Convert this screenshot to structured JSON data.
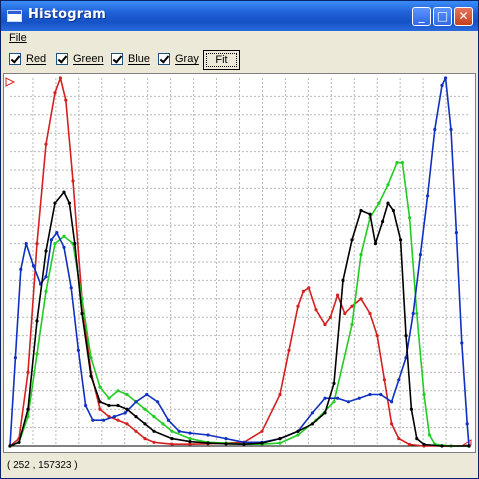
{
  "window": {
    "title": "Histogram",
    "buttons": {
      "minimize": "_",
      "maximize": "□",
      "close": "✕"
    }
  },
  "menu": {
    "file": "File"
  },
  "toolbar": {
    "checkboxes": [
      {
        "label": "Red",
        "checked": true,
        "color": "#d42020"
      },
      {
        "label": "Green",
        "checked": true,
        "color": "#22cc22"
      },
      {
        "label": "Blue",
        "checked": true,
        "color": "#1030c0"
      },
      {
        "label": "Gray",
        "checked": true,
        "color": "#000000"
      }
    ],
    "fit_label": "Fit"
  },
  "status": {
    "text": "( 252 , 157323 )"
  },
  "chart_data": {
    "type": "line",
    "title": "",
    "xlabel": "",
    "ylabel": "",
    "xlim": [
      0,
      255
    ],
    "ylim": [
      0,
      1
    ],
    "grid": true,
    "series": [
      {
        "name": "Red",
        "color": "#d42020",
        "points": [
          [
            0,
            0
          ],
          [
            5,
            0.02
          ],
          [
            10,
            0.2
          ],
          [
            15,
            0.55
          ],
          [
            20,
            0.82
          ],
          [
            25,
            0.96
          ],
          [
            28,
            1.0
          ],
          [
            31,
            0.94
          ],
          [
            35,
            0.72
          ],
          [
            40,
            0.4
          ],
          [
            45,
            0.2
          ],
          [
            50,
            0.1
          ],
          [
            55,
            0.08
          ],
          [
            60,
            0.07
          ],
          [
            65,
            0.06
          ],
          [
            70,
            0.04
          ],
          [
            75,
            0.02
          ],
          [
            80,
            0.01
          ],
          [
            90,
            0.005
          ],
          [
            100,
            0.005
          ],
          [
            110,
            0.006
          ],
          [
            120,
            0.008
          ],
          [
            130,
            0.01
          ],
          [
            140,
            0.04
          ],
          [
            150,
            0.14
          ],
          [
            155,
            0.26
          ],
          [
            160,
            0.38
          ],
          [
            163,
            0.42
          ],
          [
            166,
            0.43
          ],
          [
            170,
            0.37
          ],
          [
            175,
            0.33
          ],
          [
            178,
            0.35
          ],
          [
            182,
            0.41
          ],
          [
            186,
            0.36
          ],
          [
            190,
            0.38
          ],
          [
            195,
            0.4
          ],
          [
            200,
            0.36
          ],
          [
            204,
            0.3
          ],
          [
            208,
            0.18
          ],
          [
            212,
            0.06
          ],
          [
            216,
            0.02
          ],
          [
            222,
            0.004
          ],
          [
            230,
            0.0
          ],
          [
            245,
            0.0
          ],
          [
            255,
            0.0
          ]
        ]
      },
      {
        "name": "Green",
        "color": "#22cc22",
        "points": [
          [
            0,
            0
          ],
          [
            5,
            0.01
          ],
          [
            10,
            0.08
          ],
          [
            15,
            0.25
          ],
          [
            20,
            0.42
          ],
          [
            25,
            0.55
          ],
          [
            30,
            0.57
          ],
          [
            35,
            0.55
          ],
          [
            40,
            0.4
          ],
          [
            45,
            0.24
          ],
          [
            50,
            0.16
          ],
          [
            55,
            0.13
          ],
          [
            60,
            0.15
          ],
          [
            65,
            0.14
          ],
          [
            70,
            0.12
          ],
          [
            75,
            0.1
          ],
          [
            80,
            0.08
          ],
          [
            85,
            0.06
          ],
          [
            90,
            0.04
          ],
          [
            100,
            0.02
          ],
          [
            110,
            0.01
          ],
          [
            120,
            0.008
          ],
          [
            130,
            0.005
          ],
          [
            140,
            0.005
          ],
          [
            150,
            0.008
          ],
          [
            160,
            0.03
          ],
          [
            170,
            0.07
          ],
          [
            180,
            0.12
          ],
          [
            190,
            0.33
          ],
          [
            195,
            0.52
          ],
          [
            200,
            0.62
          ],
          [
            205,
            0.66
          ],
          [
            210,
            0.71
          ],
          [
            215,
            0.77
          ],
          [
            218,
            0.77
          ],
          [
            222,
            0.62
          ],
          [
            226,
            0.36
          ],
          [
            230,
            0.14
          ],
          [
            233,
            0.03
          ],
          [
            236,
            0.005
          ],
          [
            245,
            0.0
          ],
          [
            255,
            0.0
          ]
        ]
      },
      {
        "name": "Blue",
        "color": "#1030c0",
        "points": [
          [
            0,
            0
          ],
          [
            3,
            0.24
          ],
          [
            6,
            0.48
          ],
          [
            9,
            0.55
          ],
          [
            13,
            0.49
          ],
          [
            17,
            0.44
          ],
          [
            20,
            0.46
          ],
          [
            23,
            0.56
          ],
          [
            26,
            0.58
          ],
          [
            30,
            0.54
          ],
          [
            34,
            0.43
          ],
          [
            38,
            0.26
          ],
          [
            42,
            0.11
          ],
          [
            46,
            0.07
          ],
          [
            52,
            0.07
          ],
          [
            58,
            0.08
          ],
          [
            64,
            0.09
          ],
          [
            70,
            0.12
          ],
          [
            76,
            0.14
          ],
          [
            82,
            0.12
          ],
          [
            88,
            0.07
          ],
          [
            94,
            0.04
          ],
          [
            100,
            0.035
          ],
          [
            110,
            0.03
          ],
          [
            120,
            0.02
          ],
          [
            130,
            0.01
          ],
          [
            140,
            0.01
          ],
          [
            150,
            0.02
          ],
          [
            160,
            0.04
          ],
          [
            168,
            0.09
          ],
          [
            175,
            0.13
          ],
          [
            182,
            0.13
          ],
          [
            188,
            0.12
          ],
          [
            194,
            0.13
          ],
          [
            200,
            0.14
          ],
          [
            206,
            0.14
          ],
          [
            212,
            0.12
          ],
          [
            216,
            0.18
          ],
          [
            220,
            0.24
          ],
          [
            224,
            0.36
          ],
          [
            228,
            0.52
          ],
          [
            232,
            0.68
          ],
          [
            236,
            0.86
          ],
          [
            240,
            0.98
          ],
          [
            242,
            1.0
          ],
          [
            245,
            0.86
          ],
          [
            248,
            0.58
          ],
          [
            251,
            0.28
          ],
          [
            254,
            0.06
          ],
          [
            255,
            0.0
          ]
        ]
      },
      {
        "name": "Gray",
        "color": "#000000",
        "points": [
          [
            0,
            0
          ],
          [
            5,
            0.01
          ],
          [
            10,
            0.1
          ],
          [
            15,
            0.34
          ],
          [
            20,
            0.53
          ],
          [
            25,
            0.66
          ],
          [
            30,
            0.69
          ],
          [
            33,
            0.66
          ],
          [
            36,
            0.55
          ],
          [
            40,
            0.36
          ],
          [
            45,
            0.19
          ],
          [
            50,
            0.12
          ],
          [
            55,
            0.11
          ],
          [
            60,
            0.11
          ],
          [
            65,
            0.1
          ],
          [
            70,
            0.08
          ],
          [
            75,
            0.06
          ],
          [
            80,
            0.04
          ],
          [
            90,
            0.02
          ],
          [
            100,
            0.012
          ],
          [
            110,
            0.008
          ],
          [
            120,
            0.006
          ],
          [
            130,
            0.005
          ],
          [
            140,
            0.008
          ],
          [
            150,
            0.02
          ],
          [
            160,
            0.04
          ],
          [
            168,
            0.06
          ],
          [
            175,
            0.09
          ],
          [
            180,
            0.17
          ],
          [
            185,
            0.45
          ],
          [
            190,
            0.56
          ],
          [
            195,
            0.64
          ],
          [
            200,
            0.63
          ],
          [
            203,
            0.55
          ],
          [
            207,
            0.61
          ],
          [
            210,
            0.66
          ],
          [
            213,
            0.64
          ],
          [
            217,
            0.56
          ],
          [
            220,
            0.3
          ],
          [
            223,
            0.1
          ],
          [
            226,
            0.02
          ],
          [
            230,
            0.004
          ],
          [
            240,
            0.0
          ],
          [
            255,
            0.0
          ]
        ]
      }
    ]
  }
}
